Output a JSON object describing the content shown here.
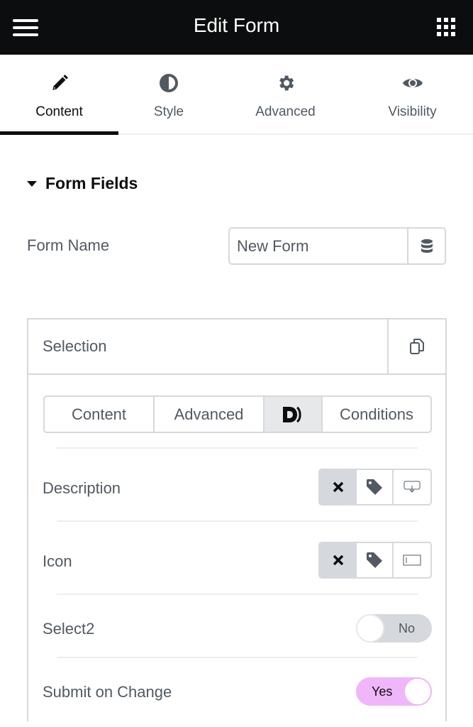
{
  "header": {
    "title": "Edit Form",
    "menu_icon": "hamburger-icon",
    "apps_icon": "grid-icon"
  },
  "tabs": [
    {
      "label": "Content",
      "icon": "pencil-icon",
      "active": true
    },
    {
      "label": "Style",
      "icon": "half-circle-icon",
      "active": false
    },
    {
      "label": "Advanced",
      "icon": "gear-icon",
      "active": false
    },
    {
      "label": "Visibility",
      "icon": "eye-icon",
      "active": false
    }
  ],
  "section": {
    "title": "Form Fields"
  },
  "form_name": {
    "label": "Form Name",
    "value": "New Form",
    "dynamic_icon": "database-icon"
  },
  "repeater": {
    "item_title": "Selection",
    "duplicate_icon": "copy-icon",
    "inner_tabs": [
      {
        "label": "Content",
        "active": false
      },
      {
        "label": "Advanced",
        "active": false
      },
      {
        "label": "D)",
        "icon": "dynamic-logo-icon",
        "active": true
      },
      {
        "label": "Conditions",
        "active": false
      }
    ],
    "rows": [
      {
        "label": "Description",
        "type": "choose",
        "options": [
          "none",
          "tag",
          "tooltip"
        ],
        "selected": "none"
      },
      {
        "label": "Icon",
        "type": "choose",
        "options": [
          "none",
          "tag",
          "input"
        ],
        "selected": "none"
      },
      {
        "label": "Select2",
        "type": "switch",
        "value": false,
        "state_label": "No"
      },
      {
        "label": "Submit on Change",
        "type": "switch",
        "value": true,
        "state_label": "Yes"
      }
    ]
  },
  "colors": {
    "accent_on": "#f0b6fa",
    "dark": "#0c0d0e",
    "text": "#515962",
    "border": "#d5d8dc"
  }
}
